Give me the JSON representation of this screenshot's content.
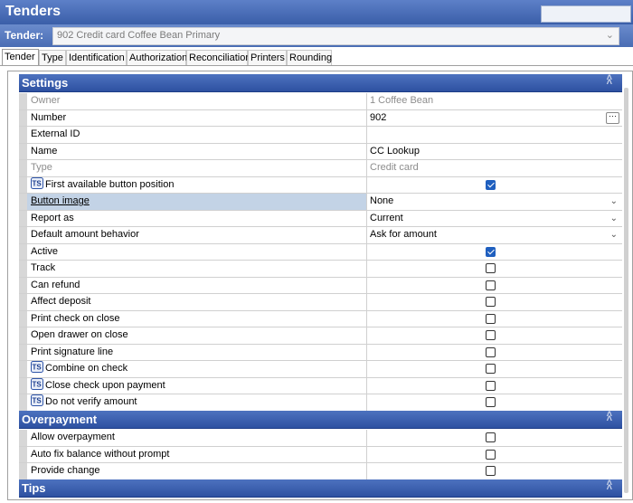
{
  "window": {
    "title": "Tenders"
  },
  "tender_selector": {
    "label": "Tender:",
    "value": "902  Credit card Coffee Bean Primary"
  },
  "tabs": [
    "Tender",
    "Type",
    "Identification",
    "Authorization",
    "Reconciliation",
    "Printers",
    "Rounding"
  ],
  "sections": {
    "settings": "Settings",
    "overpayment": "Overpayment",
    "tips": "Tips"
  },
  "settings_rows": [
    {
      "name": "Owner",
      "value": "1  Coffee Bean",
      "kind": "text",
      "gray": true
    },
    {
      "name": "Number",
      "value": "902",
      "kind": "text-ellipsis"
    },
    {
      "name": "External ID",
      "value": "",
      "kind": "text"
    },
    {
      "name": "Name",
      "value": "CC Lookup",
      "kind": "text"
    },
    {
      "name": "Type",
      "value": "Credit card",
      "kind": "text",
      "gray": true
    },
    {
      "name": "First available button position",
      "kind": "check",
      "checked": true,
      "ts": true
    },
    {
      "name": "Button image",
      "value": "None",
      "kind": "dropdown",
      "link": true,
      "selected": true
    },
    {
      "name": "Report as",
      "value": "Current",
      "kind": "dropdown"
    },
    {
      "name": "Default amount behavior",
      "value": "Ask for amount",
      "kind": "dropdown"
    },
    {
      "name": "Active",
      "kind": "check",
      "checked": true
    },
    {
      "name": "Track",
      "kind": "check",
      "checked": false
    },
    {
      "name": "Can refund",
      "kind": "check",
      "checked": false
    },
    {
      "name": "Affect deposit",
      "kind": "check",
      "checked": false
    },
    {
      "name": "Print check on close",
      "kind": "check",
      "checked": false
    },
    {
      "name": "Open drawer on close",
      "kind": "check",
      "checked": false
    },
    {
      "name": "Print signature line",
      "kind": "check",
      "checked": false
    },
    {
      "name": "Combine on check",
      "kind": "check",
      "checked": false,
      "ts": true
    },
    {
      "name": "Close check upon payment",
      "kind": "check",
      "checked": false,
      "ts": true
    },
    {
      "name": "Do not verify amount",
      "kind": "check",
      "checked": false,
      "ts": true
    }
  ],
  "overpayment_rows": [
    {
      "name": "Allow overpayment",
      "kind": "check",
      "checked": false
    },
    {
      "name": "Auto fix balance without prompt",
      "kind": "check",
      "checked": false
    },
    {
      "name": "Provide change",
      "kind": "check",
      "checked": false
    }
  ],
  "icons": {
    "collapse": "double-chevron-up-icon",
    "dropdown": "chevron-down-icon",
    "ts": "ts-mode-icon",
    "ellipsis": "ellipsis-icon"
  },
  "colors": {
    "header": "#3a5ea8",
    "section": "#2e51a1",
    "checkbox_on": "#1f5fbf",
    "selected_row": "#c3d3e6"
  }
}
